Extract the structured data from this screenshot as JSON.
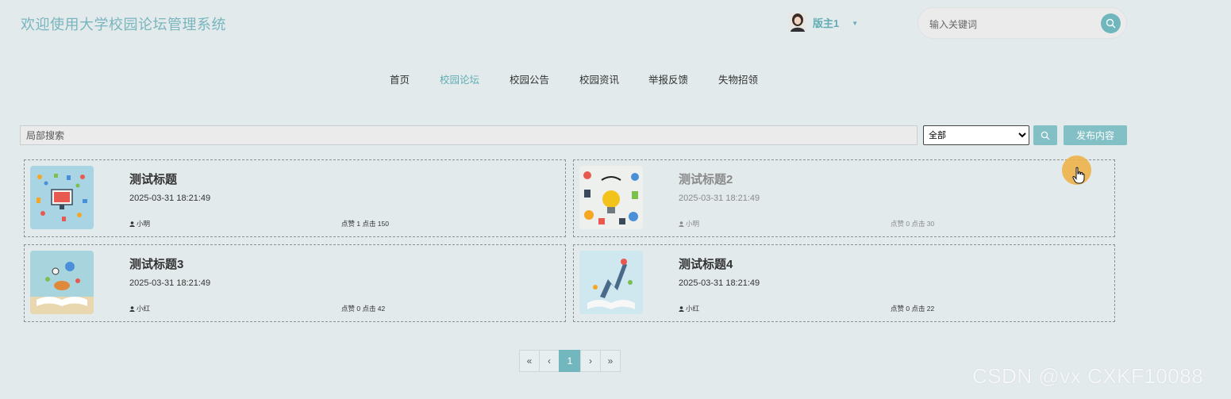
{
  "header": {
    "site_title": "欢迎使用大学校园论坛管理系统",
    "user_name": "版主1",
    "search_placeholder": "输入关键词"
  },
  "nav": {
    "items": [
      {
        "label": "首页",
        "active": false
      },
      {
        "label": "校园论坛",
        "active": true
      },
      {
        "label": "校园公告",
        "active": false
      },
      {
        "label": "校园资讯",
        "active": false
      },
      {
        "label": "举报反馈",
        "active": false
      },
      {
        "label": "失物招领",
        "active": false
      }
    ]
  },
  "filter": {
    "search_placeholder": "局部搜索",
    "category_selected": "全部",
    "publish_label": "发布内容"
  },
  "posts": [
    {
      "title": "测试标题",
      "date": "2025-03-31 18:21:49",
      "author": "小明",
      "stats": "点赞 1 点击 150"
    },
    {
      "title": "测试标题2",
      "date": "2025-03-31 18:21:49",
      "author": "小明",
      "stats": "点赞 0 点击 30"
    },
    {
      "title": "测试标题3",
      "date": "2025-03-31 18:21:49",
      "author": "小红",
      "stats": "点赞 0 点击 42"
    },
    {
      "title": "测试标题4",
      "date": "2025-03-31 18:21:49",
      "author": "小红",
      "stats": "点赞 0 点击 22"
    }
  ],
  "pagination": {
    "first": "«",
    "prev": "‹",
    "current": "1",
    "next": "›",
    "last": "»"
  },
  "watermark": "CSDN @vx  CXKF10088",
  "colors": {
    "accent": "#63adb5",
    "button": "#83c0c5",
    "background": "#e2eaec",
    "cursor_highlight": "#edb24a"
  }
}
